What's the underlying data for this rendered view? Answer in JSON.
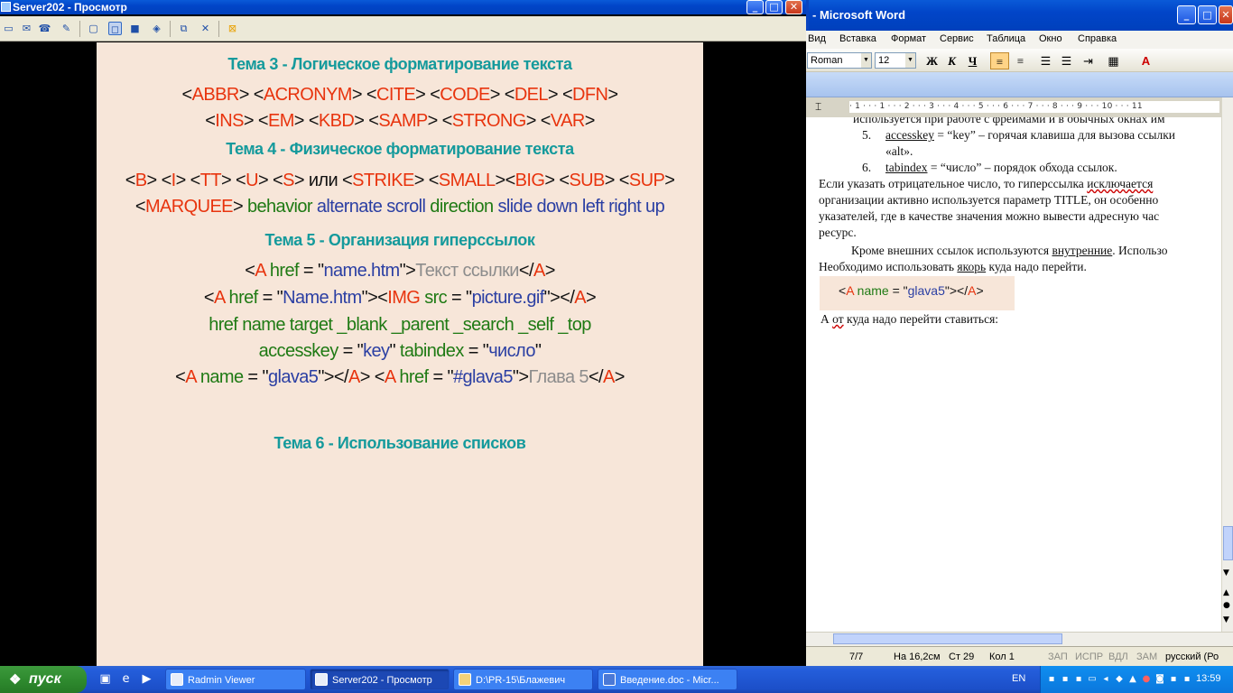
{
  "viewer": {
    "title": "Server202 - Просмотр",
    "buttons": {
      "minimize": "_",
      "maximize": "□",
      "close": "✕"
    },
    "toolbar_icons": [
      "monitor-icon",
      "chat-icon",
      "phone-icon",
      "message-icon",
      "window-icon",
      "fullscreen-icon",
      "scale-icon",
      "fit-icon",
      "copy-icon",
      "tools-icon",
      "disconnect-icon"
    ]
  },
  "slide": {
    "heading3": "Тема 3 - Логическое форматирование текста",
    "tags3_line1": [
      [
        "<",
        "blk"
      ],
      [
        "ABBR",
        "red"
      ],
      [
        "> <",
        "blk"
      ],
      [
        "ACRONYM",
        "red"
      ],
      [
        "> <",
        "blk"
      ],
      [
        "CITE",
        "red"
      ],
      [
        ">  <",
        "blk"
      ],
      [
        "CODE",
        "red"
      ],
      [
        "> <",
        "blk"
      ],
      [
        "DEL",
        "red"
      ],
      [
        "> <",
        "blk"
      ],
      [
        "DFN",
        "red"
      ],
      [
        ">",
        "blk"
      ]
    ],
    "tags3_line2": [
      [
        "<",
        "blk"
      ],
      [
        "INS",
        "red"
      ],
      [
        "> <",
        "blk"
      ],
      [
        "EM",
        "red"
      ],
      [
        "> <",
        "blk"
      ],
      [
        "KBD",
        "red"
      ],
      [
        "> <",
        "blk"
      ],
      [
        "SAMP",
        "red"
      ],
      [
        "> <",
        "blk"
      ],
      [
        "STRONG",
        "red"
      ],
      [
        "> <",
        "blk"
      ],
      [
        "VAR",
        "red"
      ],
      [
        ">",
        "blk"
      ]
    ],
    "heading4": "Тема 4 - Физическое форматирование текста",
    "tags4_line1": [
      [
        "<",
        "blk"
      ],
      [
        "B",
        "red"
      ],
      [
        "> <",
        "blk"
      ],
      [
        "I",
        "red"
      ],
      [
        ">  <",
        "blk"
      ],
      [
        "TT",
        "red"
      ],
      [
        "> <",
        "blk"
      ],
      [
        "U",
        "red"
      ],
      [
        "> <",
        "blk"
      ],
      [
        "S",
        "red"
      ],
      [
        "> или <",
        "blk"
      ],
      [
        "STRIKE",
        "red"
      ],
      [
        ">  <",
        "blk"
      ],
      [
        "SMALL",
        "red"
      ],
      [
        "><",
        "blk"
      ],
      [
        "BIG",
        "red"
      ],
      [
        "> <",
        "blk"
      ],
      [
        "SUB",
        "red"
      ],
      [
        "> <",
        "blk"
      ],
      [
        "SUP",
        "red"
      ],
      [
        ">",
        "blk"
      ]
    ],
    "tags4_line2": [
      [
        "<",
        "blk"
      ],
      [
        "MARQUEE",
        "red"
      ],
      [
        "> ",
        "blk"
      ],
      [
        "behavior ",
        "grn"
      ],
      [
        "alternate ",
        "blu"
      ],
      [
        "scroll ",
        "blu"
      ],
      [
        "direction ",
        "grn"
      ],
      [
        "slide ",
        "blu"
      ],
      [
        " down ",
        "blu"
      ],
      [
        "left ",
        "blu"
      ],
      [
        "right ",
        "blu"
      ],
      [
        "up",
        "blu"
      ]
    ],
    "heading5": "Тема 5 - Организация гиперссылок",
    "links_line1": [
      [
        "<",
        "blk"
      ],
      [
        "A",
        "red"
      ],
      [
        " href",
        "grn"
      ],
      [
        " = \"",
        "blk"
      ],
      [
        "name.htm",
        "blu"
      ],
      [
        "\">",
        "blk"
      ],
      [
        "Текст ссылки",
        "gry"
      ],
      [
        "</",
        "blk"
      ],
      [
        "A",
        "red"
      ],
      [
        ">",
        "blk"
      ]
    ],
    "links_line2": [
      [
        "<",
        "blk"
      ],
      [
        "A",
        "red"
      ],
      [
        " href",
        "grn"
      ],
      [
        " = \"",
        "blk"
      ],
      [
        "Name.htm",
        "blu"
      ],
      [
        "\"><",
        "blk"
      ],
      [
        "IMG",
        "red"
      ],
      [
        " src",
        "grn"
      ],
      [
        " = \"",
        "blk"
      ],
      [
        "picture.gif",
        "blu"
      ],
      [
        "\"></",
        "blk"
      ],
      [
        "A",
        "red"
      ],
      [
        ">",
        "blk"
      ]
    ],
    "links_line3": [
      [
        "href  name  target  _blank  _parent  _search  _self  _top",
        "grn"
      ]
    ],
    "links_line4": [
      [
        "accesskey",
        "grn"
      ],
      [
        " = \"",
        "blk"
      ],
      [
        "key",
        "blu"
      ],
      [
        "\" ",
        "blk"
      ],
      [
        "tabindex",
        "grn"
      ],
      [
        " = \"",
        "blk"
      ],
      [
        "число",
        "blu"
      ],
      [
        "\"",
        "blk"
      ]
    ],
    "links_line5": [
      [
        "<",
        "blk"
      ],
      [
        "A",
        "red"
      ],
      [
        " name",
        "grn"
      ],
      [
        " = \"",
        "blk"
      ],
      [
        "glava5",
        "blu"
      ],
      [
        "\"></",
        "blk"
      ],
      [
        "A",
        "red"
      ],
      [
        ">  <",
        "blk"
      ],
      [
        "A",
        "red"
      ],
      [
        " href",
        "grn"
      ],
      [
        " = \"",
        "blk"
      ],
      [
        "#glava5",
        "blu"
      ],
      [
        "\">",
        "blk"
      ],
      [
        "Глава 5",
        "gry"
      ],
      [
        "</",
        "blk"
      ],
      [
        "A",
        "red"
      ],
      [
        ">",
        "blk"
      ]
    ],
    "heading6": "Тема 6 - Использование списков"
  },
  "word": {
    "title": "- Microsoft Word",
    "menu": [
      "Вид",
      "Вставка",
      "Формат",
      "Сервис",
      "Таблица",
      "Окно",
      "Справка"
    ],
    "font_name": "Roman",
    "font_size": "12",
    "format_buttons": [
      "Ж",
      "К",
      "Ч"
    ],
    "ruler_text": "· 1 · · · 1 · · · 2 · · · 3 · · · 4 · · · 5 · · · 6 · · · 7 · · · 8 · · · 9 · · · 10 · · · 11",
    "doc": {
      "cut_line": "используется при работе с фреймами и в обычных окнах им",
      "item5_num": "5.",
      "item5_key": "accesskey",
      "item5_rest": " = “key” – горячая клавиша для вызова ссылки",
      "item5_cont": "«alt».",
      "item6_num": "6.",
      "item6_key": "tabindex",
      "item6_rest": " = “число” – порядок обхода ссылок.",
      "para1_l1a": " Если указать отрицательное число, то гиперссылка ",
      "para1_l1b": "исключается",
      "para1_l2": "организации активно используется параметр TITLE, он особенно",
      "para1_l3": "указателей, где в качестве значения можно вывести адресную час",
      "para1_l4": "ресурс.",
      "para2_l1a": "Кроме внешних ссылок используются ",
      "para2_l1b": "внутренние",
      "para2_l1c": ". Использо",
      "para2_l2a": "Необходимо использовать ",
      "para2_l2b": "якорь",
      "para2_l2c": " куда надо перейти.",
      "code_parts": [
        [
          "<",
          "blk"
        ],
        [
          "A",
          "red"
        ],
        [
          " name",
          "grn"
        ],
        [
          " = \"",
          "blk"
        ],
        [
          "glava5",
          "blu"
        ],
        [
          "\"></",
          "blk"
        ],
        [
          "A",
          "red"
        ],
        [
          ">",
          "blk"
        ]
      ],
      "last_a": "А ",
      "last_b": "от",
      "last_c": " куда надо перейти ставиться:"
    },
    "status": {
      "page": "7/7",
      "position": "На 16,2см",
      "line": "Ст  29",
      "col": "Кол  1",
      "rec": "ЗАП",
      "trk": "ИСПР",
      "ext": "ВДЛ",
      "ovr": "ЗАМ",
      "lang": "русский (Ро"
    }
  },
  "taskbar": {
    "start": "пуск",
    "tasks": [
      "Radmin Viewer",
      "Server202 - Просмотр",
      "D:\\PR-15\\Блажевич",
      "Введение.doc - Micr..."
    ],
    "lang": "EN",
    "clock": "13:59"
  }
}
